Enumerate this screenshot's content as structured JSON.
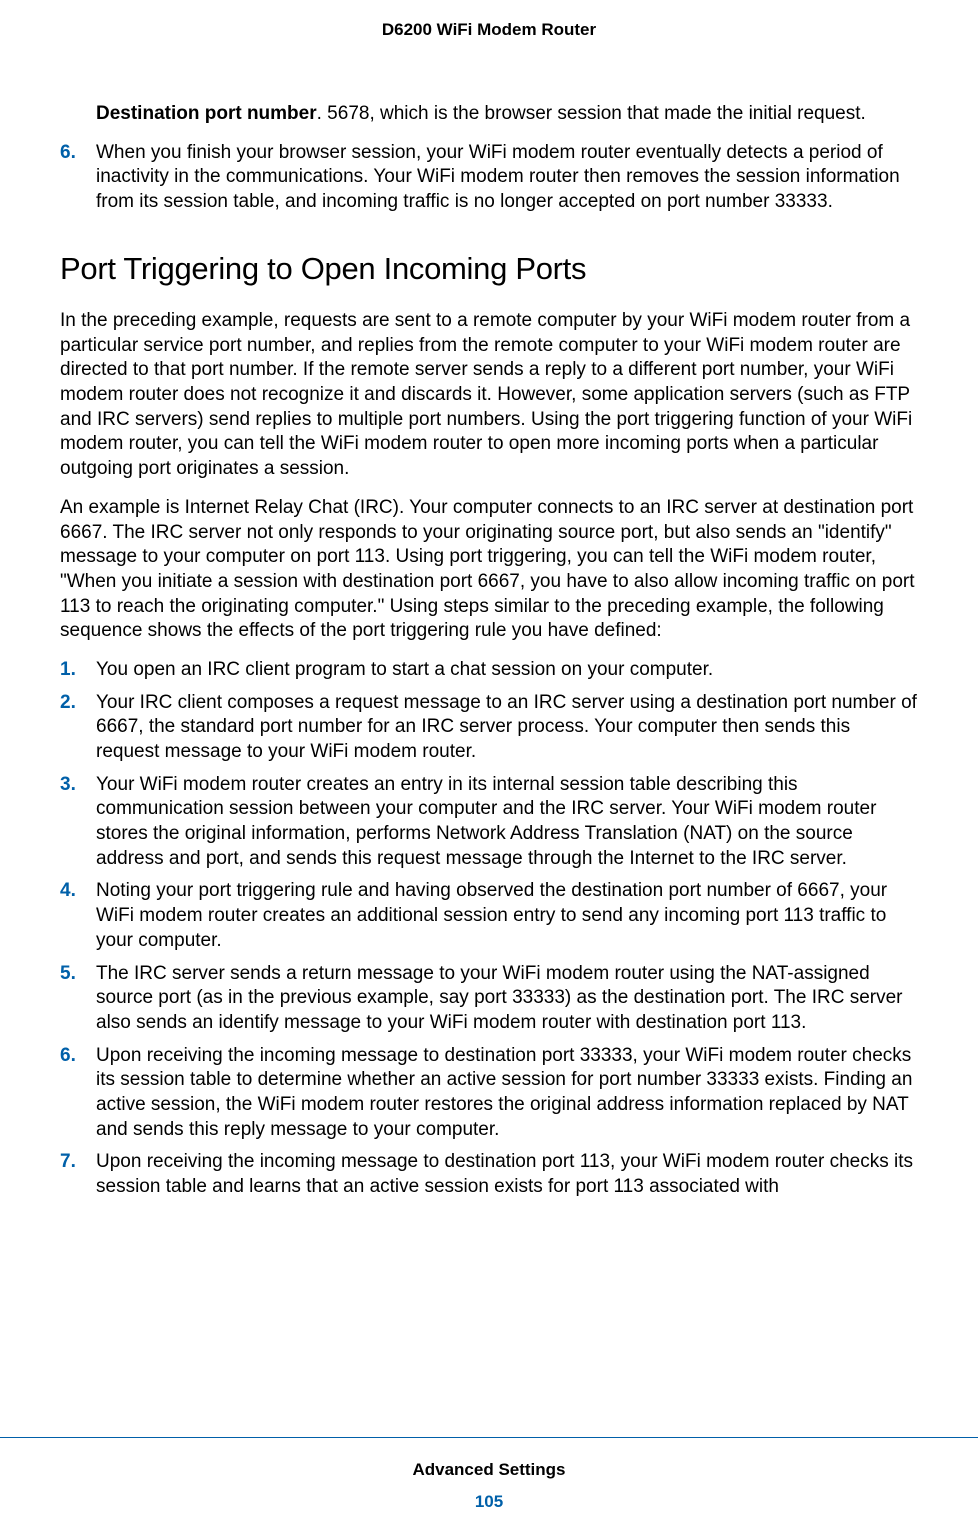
{
  "header": {
    "title": "D6200 WiFi Modem Router"
  },
  "body": {
    "destPortLabel": "Destination port number",
    "destPortText": ". 5678, which is the browser session that made the initial request.",
    "topList": {
      "num6": "6.",
      "item6": "When you finish your browser session, your WiFi modem router eventually detects a period of inactivity in the communications. Your WiFi modem router then removes the session information from its session table, and incoming traffic is no longer accepted on port number 33333."
    },
    "heading": "Port Triggering to Open Incoming Ports",
    "para1": "In the preceding example, requests are sent to a remote computer by your WiFi modem router from a particular service port number, and replies from the remote computer to your WiFi modem router are directed to that port number. If the remote server sends a reply to a different port number, your WiFi modem router does not recognize it and discards it. However, some application servers (such as FTP and IRC servers) send replies to multiple port numbers. Using the port triggering function of your WiFi modem router, you can tell the WiFi modem router to open more incoming ports when a particular outgoing port originates a session.",
    "para2": "An example is Internet Relay Chat (IRC). Your computer connects to an IRC server at destination port 6667. The IRC server not only responds to your originating source port, but also sends an \"identify\" message to your computer on port 113. Using port triggering, you can tell the WiFi modem router, \"When you initiate a session with destination port 6667, you have to also allow incoming traffic on port 113 to reach the originating computer.\" Using steps similar to the preceding example, the following sequence shows the effects of the port triggering rule you have defined:",
    "list": {
      "n1": "1.",
      "t1": "You open an IRC client program to start a chat session on your computer.",
      "n2": "2.",
      "t2": "Your IRC client composes a request message to an IRC server using a destination port number of 6667, the standard port number for an IRC server process. Your computer then sends this request message to your WiFi modem router.",
      "n3": "3.",
      "t3": "Your WiFi modem router creates an entry in its internal session table describing this communication session between your computer and the IRC server. Your WiFi modem router stores the original information, performs Network Address Translation (NAT) on the source address and port, and sends this request message through the Internet to the IRC server.",
      "n4": "4.",
      "t4": "Noting your port triggering rule and having observed the destination port number of 6667, your WiFi modem router creates an additional session entry to send any incoming port 113 traffic to your computer.",
      "n5": "5.",
      "t5": "The IRC server sends a return message to your WiFi modem router using the NAT-assigned source port (as in the previous example, say port 33333) as the destination port. The IRC server also sends an identify message to your WiFi modem router with destination port 113.",
      "n6": "6.",
      "t6": "Upon receiving the incoming message to destination port 33333, your WiFi modem router checks its session table to determine whether an active session for port number 33333 exists. Finding an active session, the WiFi modem router restores the original address information replaced by NAT and sends this reply message to your computer.",
      "n7": "7.",
      "t7": "Upon receiving the incoming message to destination port 113, your WiFi modem router checks its session table and learns that an active session exists for port 113 associated with"
    }
  },
  "footer": {
    "section": "Advanced Settings",
    "page": "105"
  }
}
